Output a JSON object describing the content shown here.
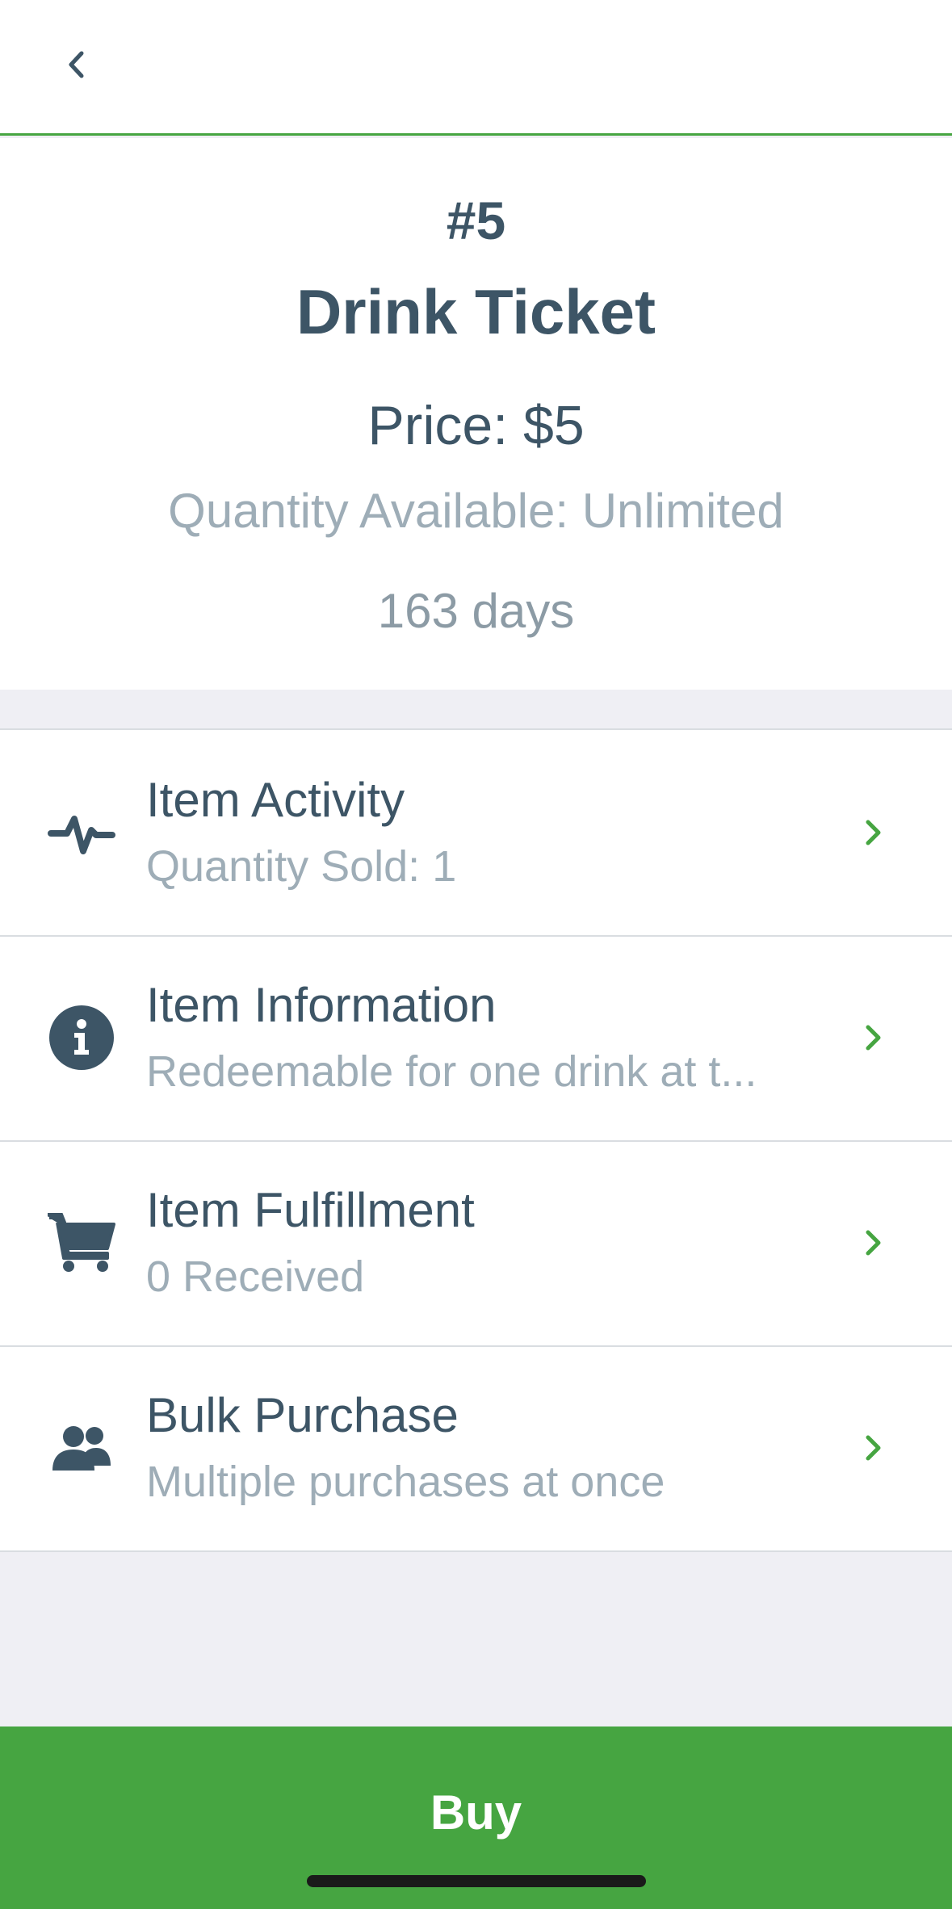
{
  "nav": {
    "back_icon": "chevron-left-icon"
  },
  "item": {
    "number": "#5",
    "title": "Drink Ticket",
    "price": "Price: $5",
    "quantity": "Quantity Available: Unlimited",
    "days": "163 days"
  },
  "rows": [
    {
      "icon": "activity-pulse-icon",
      "title": "Item Activity",
      "subtitle": "Quantity Sold: 1"
    },
    {
      "icon": "info-circle-icon",
      "title": "Item Information",
      "subtitle": "Redeemable for one drink at t..."
    },
    {
      "icon": "shopping-cart-icon",
      "title": "Item Fulfillment",
      "subtitle": "0 Received"
    },
    {
      "icon": "users-group-icon",
      "title": "Bulk Purchase",
      "subtitle": "Multiple purchases at once"
    }
  ],
  "buy": {
    "label": "Buy"
  },
  "colors": {
    "accent": "#46a541",
    "text_dark": "#3d5566",
    "text_muted": "#9eadb7",
    "background": "#efeff4"
  }
}
